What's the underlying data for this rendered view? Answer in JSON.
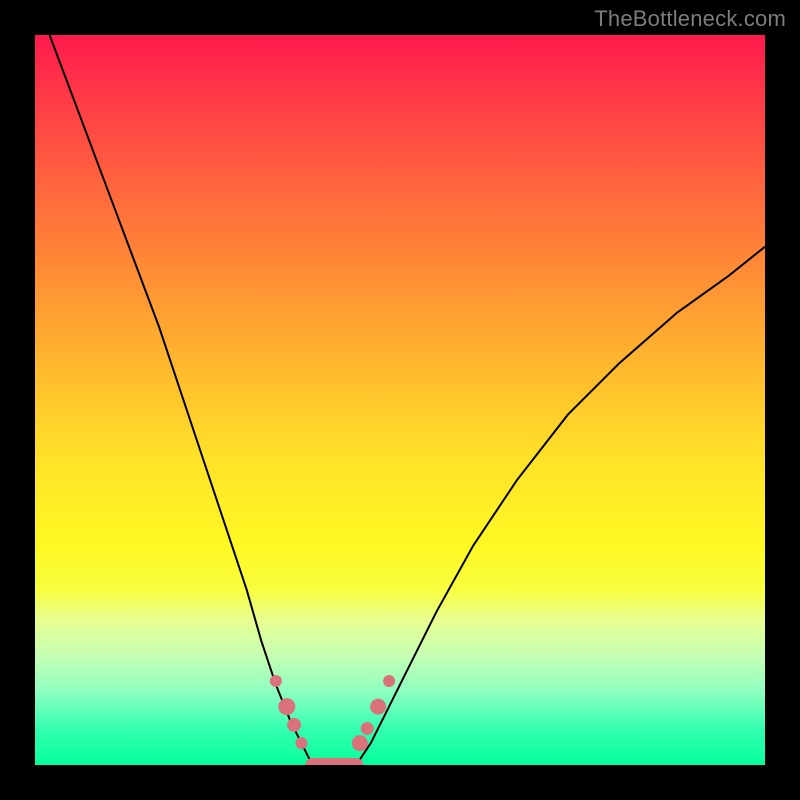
{
  "watermark": "TheBottleneck.com",
  "chart_data": {
    "type": "line",
    "title": "",
    "xlabel": "",
    "ylabel": "",
    "xlim": [
      0,
      100
    ],
    "ylim": [
      0,
      100
    ],
    "series": [
      {
        "name": "left-branch",
        "x": [
          2,
          5,
          8,
          11,
          14,
          17,
          20,
          23,
          26,
          29,
          31,
          33,
          35,
          36.5,
          38
        ],
        "values": [
          100,
          92,
          84,
          76,
          68,
          60,
          51,
          42,
          33,
          24,
          17,
          11,
          6,
          3,
          0
        ]
      },
      {
        "name": "right-branch",
        "x": [
          44,
          46,
          48,
          51,
          55,
          60,
          66,
          73,
          80,
          88,
          95,
          100
        ],
        "values": [
          0,
          3,
          7,
          13,
          21,
          30,
          39,
          48,
          55,
          62,
          67,
          71
        ]
      },
      {
        "name": "valley-floor",
        "x": [
          38,
          39,
          40,
          41,
          42,
          43,
          44
        ],
        "values": [
          0,
          0,
          0,
          0,
          0,
          0,
          0
        ]
      }
    ],
    "markers": {
      "name": "highlight-dots",
      "x": [
        33.0,
        34.5,
        35.5,
        36.5,
        44.5,
        45.5,
        47.0,
        48.5
      ],
      "values": [
        11.5,
        8.0,
        5.5,
        3.0,
        3.0,
        5.0,
        8.0,
        11.5
      ],
      "radius": [
        6.0,
        8.5,
        7.0,
        6.0,
        8.0,
        6.5,
        8.0,
        6.0
      ]
    },
    "colors": {
      "curve": "#000000",
      "markers": "#d9727b",
      "gradient_top": "#ff1a4d",
      "gradient_bottom": "#07ff9c"
    }
  }
}
